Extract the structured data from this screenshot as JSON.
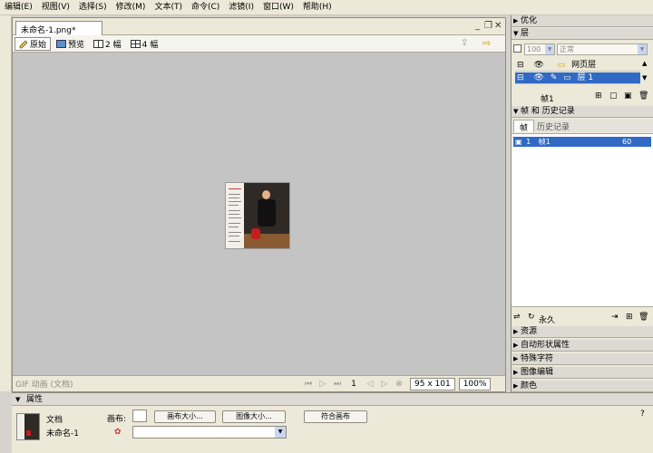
{
  "menu": [
    "编辑(E)",
    "视图(V)",
    "选择(S)",
    "修改(M)",
    "文本(T)",
    "命令(C)",
    "滤镜(I)",
    "窗口(W)",
    "帮助(H)"
  ],
  "document": {
    "tab_title": "未命名-1.png*",
    "view_tabs": [
      "原始",
      "预览",
      "2 幅",
      "4 幅"
    ],
    "status_text": "GIF 动画 (文档)",
    "frame_number": "1",
    "dimensions": "95 x 101",
    "zoom": "100%"
  },
  "panels": {
    "optimize": "优化",
    "layers": {
      "title": "层",
      "opacity": "100",
      "blend_mode": "正常",
      "rows": [
        "网页层",
        "层 1"
      ],
      "frame_label": "帧1"
    },
    "frames_history": {
      "title": "帧 和 历史记录",
      "tab_frames": "帧",
      "tab_history": "历史记录",
      "row_num": "1",
      "row_name": "帧1",
      "row_delay": "60",
      "loop": "永久"
    },
    "collapsed": [
      "资源",
      "自动形状属性",
      "特殊字符",
      "图像编辑",
      "颜色"
    ]
  },
  "properties": {
    "title": "属性",
    "doc_label": "文档",
    "doc_name": "未命名-1",
    "canvas_label": "画布:",
    "btn_canvas_size": "画布大小...",
    "btn_image_size": "图像大小...",
    "btn_fit_canvas": "符合画布",
    "help": "?"
  },
  "colors": {
    "selection": "#316ac5",
    "canvas_bg": "#c4c4c4",
    "panel_bg": "#ece9d8"
  }
}
